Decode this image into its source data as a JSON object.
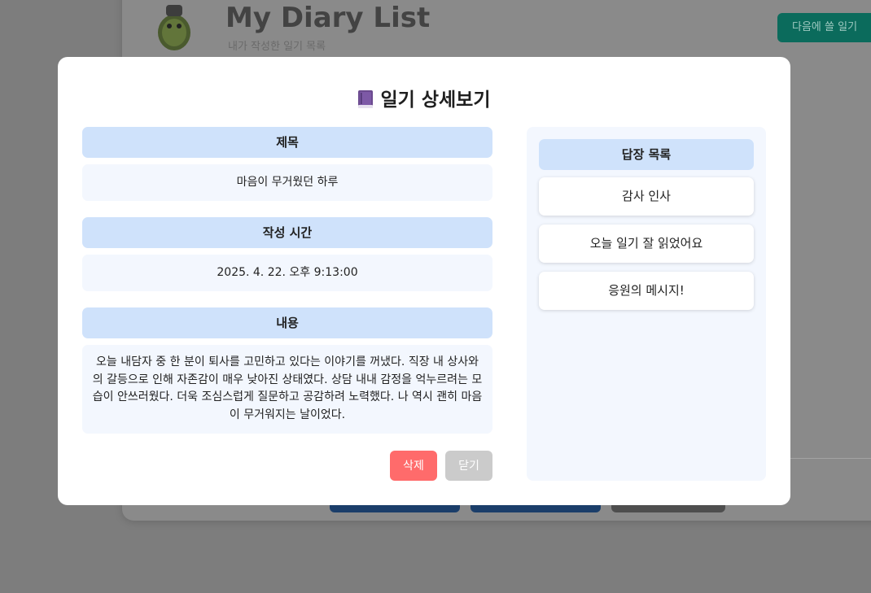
{
  "background": {
    "app_title": "My Diary List",
    "subtitle": "내가 작성한 일기 목록",
    "write_button": "다음에 쓸 일기"
  },
  "modal": {
    "title": "일기 상세보기",
    "title_icon": "book-icon",
    "title_section": {
      "label": "제목",
      "value": "마음이 무거웠던 하루"
    },
    "time_section": {
      "label": "작성 시간",
      "value": "2025. 4. 22. 오후 9:13:00"
    },
    "content_section": {
      "label": "내용",
      "value": "오늘 내담자 중 한 분이 퇴사를 고민하고 있다는 이야기를 꺼냈다. 직장 내 상사와의 갈등으로 인해 자존감이 매우 낮아진 상태였다. 상담 내내 감정을 억누르려는 모습이 안쓰러웠다. 더욱 조심스럽게 질문하고 공감하려 노력했다. 나 역시 괜히 마음이 무거워지는 날이었다."
    },
    "delete_button": "삭제",
    "close_button": "닫기",
    "replies": {
      "label": "답장 목록",
      "items": [
        "감사 인사",
        "오늘 일기 잘 읽었어요",
        "응원의 메시지!"
      ]
    }
  },
  "colors": {
    "section_header": "#cfe2fb",
    "section_body": "#f3f7fe",
    "delete": "#ff6b6b",
    "close": "#cbcbcb",
    "overlay": "#7d7d7d"
  }
}
